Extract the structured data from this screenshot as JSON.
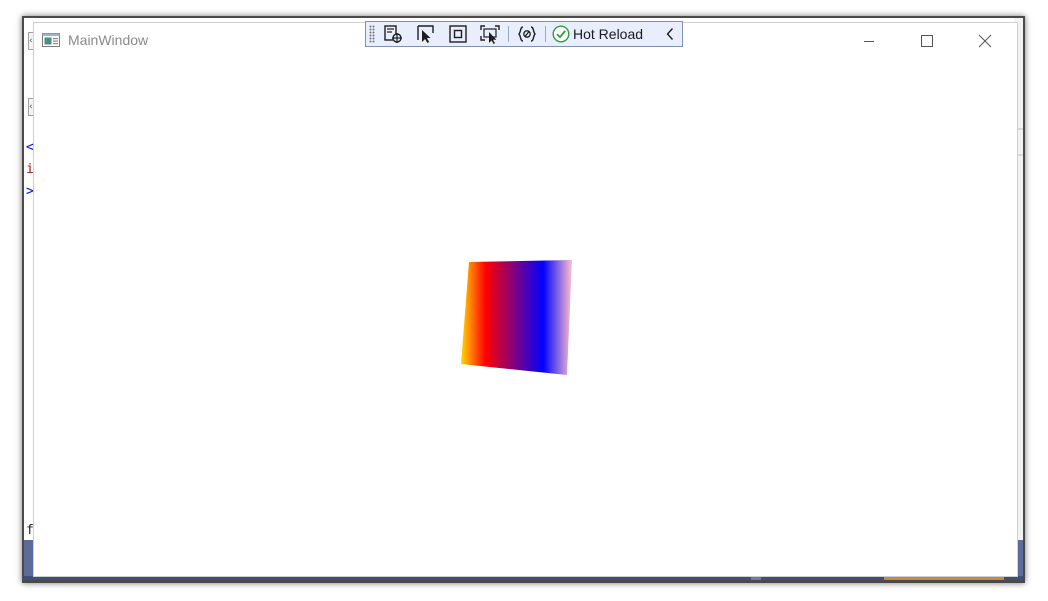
{
  "window": {
    "title": "MainWindow"
  },
  "toolbar": {
    "hot_reload_label": "Hot Reload",
    "tools": [
      {
        "icon": "live-visual-tree-icon"
      },
      {
        "icon": "select-element-icon"
      },
      {
        "icon": "display-layout-adorners-icon"
      },
      {
        "icon": "track-focused-element-icon"
      },
      {
        "icon": "binding-failures-icon"
      }
    ]
  },
  "ide_background": {
    "code_fragments": [
      "<",
      "i",
      ">",
      "f"
    ]
  },
  "content": {
    "gradient_colors": [
      "#ffd700",
      "#ff0000",
      "#800080",
      "#0000ff",
      "#ffc0cb"
    ]
  },
  "colors": {
    "ide_status_band": "#5d6b99",
    "toolbar_bg": "#e9eefc",
    "hot_reload_check": "#2e9e3e"
  }
}
